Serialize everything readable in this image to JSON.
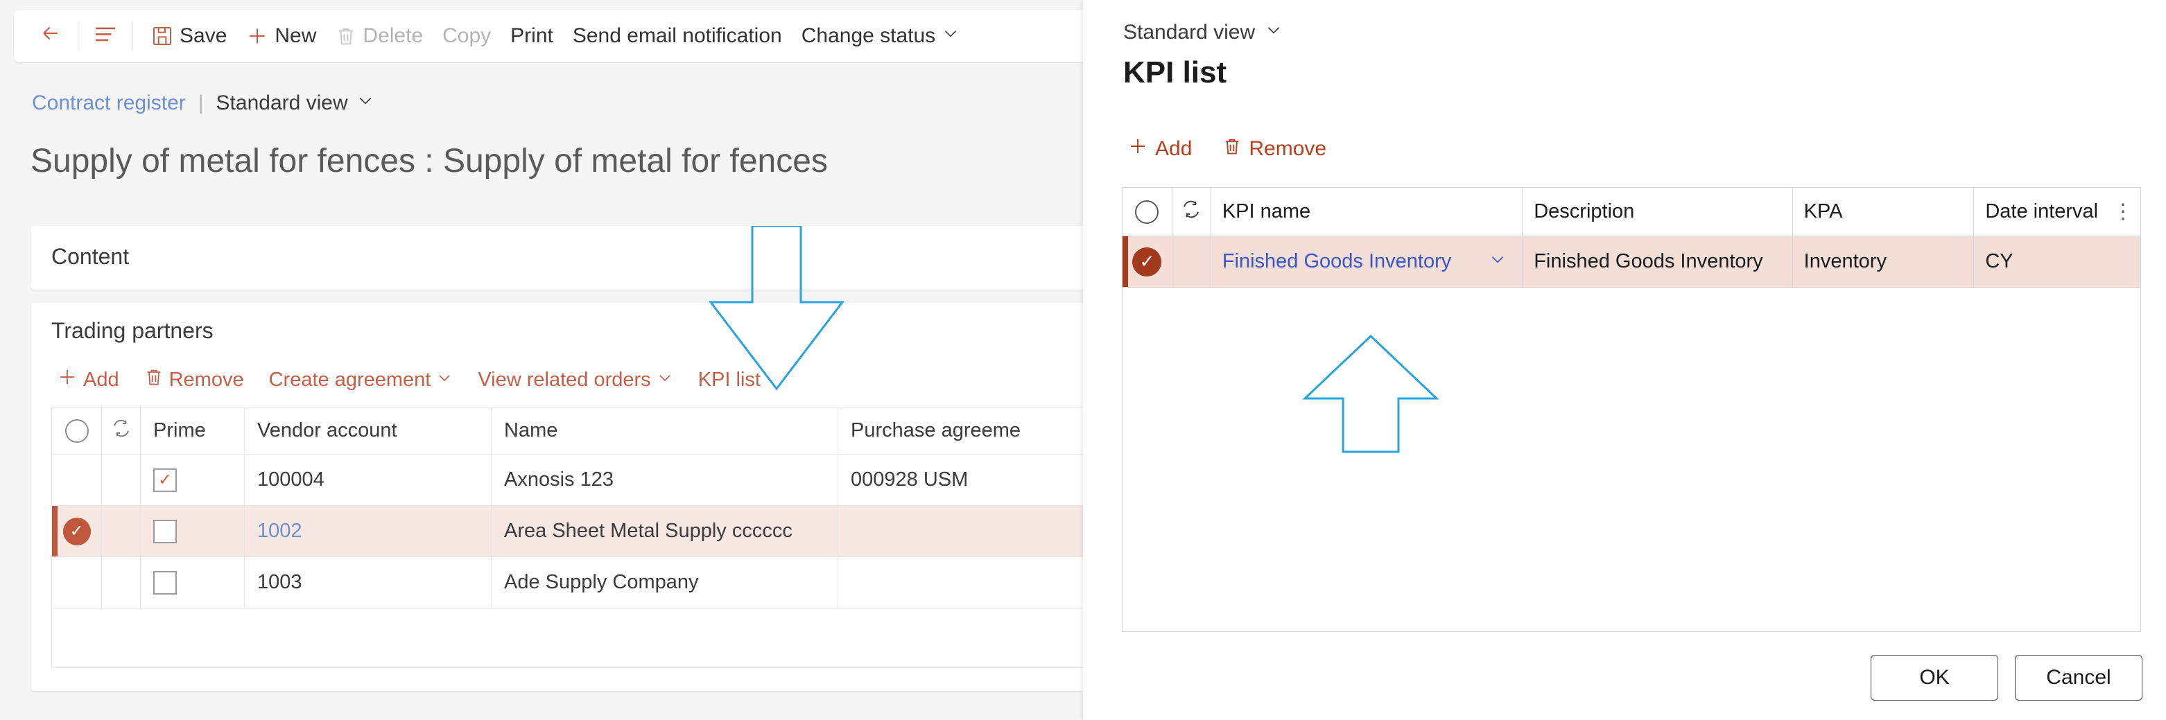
{
  "toolbar": {
    "back_icon": "back-arrow-icon",
    "menu_icon": "hamburger-menu-icon",
    "save_label": "Save",
    "save_icon": "save-disk-icon",
    "new_label": "New",
    "new_icon": "plus-icon",
    "delete_label": "Delete",
    "delete_icon": "trash-icon",
    "copy_label": "Copy",
    "print_label": "Print",
    "send_email_label": "Send email notification",
    "change_status_label": "Change status",
    "chevron": "⌄"
  },
  "breadcrumb": {
    "register_link": "Contract register",
    "divider": "|",
    "view_label": "Standard view"
  },
  "page": {
    "title": "Supply of metal for fences : Supply of metal for fences"
  },
  "content_section": {
    "title": "Content"
  },
  "trading_partners": {
    "title": "Trading partners",
    "toolbar": {
      "add_label": "Add",
      "remove_label": "Remove",
      "create_agreement_label": "Create agreement",
      "view_related_orders_label": "View related orders",
      "kpi_list_label": "KPI list"
    },
    "columns": [
      "",
      "",
      "Prime",
      "Vendor account",
      "Name",
      "Purchase agreeme"
    ],
    "rows": [
      {
        "selected": false,
        "prime_checked": true,
        "vendor_account": "100004",
        "vendor_is_link": false,
        "name": "Axnosis 123",
        "purchase_agreement": "000928      USM"
      },
      {
        "selected": true,
        "prime_checked": false,
        "vendor_account": "1002",
        "vendor_is_link": true,
        "name": "Area Sheet Metal Supply cccccc",
        "purchase_agreement": ""
      },
      {
        "selected": false,
        "prime_checked": false,
        "vendor_account": "1003",
        "vendor_is_link": false,
        "name": "Ade Supply Company",
        "purchase_agreement": ""
      }
    ]
  },
  "dialog": {
    "view_label": "Standard view",
    "title": "KPI list",
    "toolbar": {
      "add_label": "Add",
      "remove_label": "Remove"
    },
    "columns": [
      "",
      "",
      "KPI name",
      "Description",
      "KPA",
      "Date interval"
    ],
    "kebab_glyph": "⋮",
    "rows": [
      {
        "selected": true,
        "kpi_name": "Finished Goods Inventory",
        "description": "Finished Goods Inventory",
        "kpa": "Inventory",
        "date_interval": "CY"
      }
    ],
    "footer": {
      "ok_label": "OK",
      "cancel_label": "Cancel"
    }
  },
  "colors": {
    "accent": "#c45f47",
    "dialog_accent": "#b5411d",
    "selected_row_bg": "#f4ded8",
    "link": "#6e8fd4",
    "annotation": "#29a3e0"
  }
}
